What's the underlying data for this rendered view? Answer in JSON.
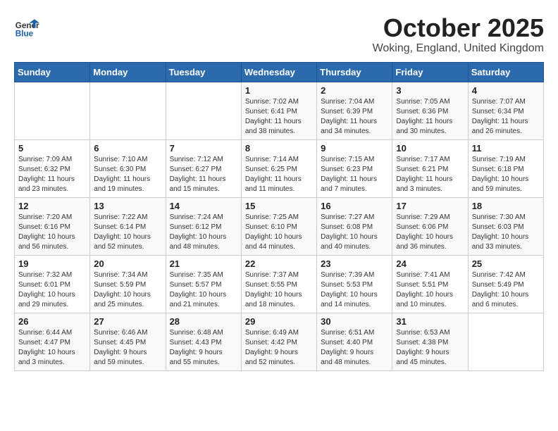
{
  "header": {
    "logo_line1": "General",
    "logo_line2": "Blue",
    "month_title": "October 2025",
    "location": "Woking, England, United Kingdom"
  },
  "weekdays": [
    "Sunday",
    "Monday",
    "Tuesday",
    "Wednesday",
    "Thursday",
    "Friday",
    "Saturday"
  ],
  "weeks": [
    [
      {
        "day": "",
        "info": ""
      },
      {
        "day": "",
        "info": ""
      },
      {
        "day": "",
        "info": ""
      },
      {
        "day": "1",
        "info": "Sunrise: 7:02 AM\nSunset: 6:41 PM\nDaylight: 11 hours\nand 38 minutes."
      },
      {
        "day": "2",
        "info": "Sunrise: 7:04 AM\nSunset: 6:39 PM\nDaylight: 11 hours\nand 34 minutes."
      },
      {
        "day": "3",
        "info": "Sunrise: 7:05 AM\nSunset: 6:36 PM\nDaylight: 11 hours\nand 30 minutes."
      },
      {
        "day": "4",
        "info": "Sunrise: 7:07 AM\nSunset: 6:34 PM\nDaylight: 11 hours\nand 26 minutes."
      }
    ],
    [
      {
        "day": "5",
        "info": "Sunrise: 7:09 AM\nSunset: 6:32 PM\nDaylight: 11 hours\nand 23 minutes."
      },
      {
        "day": "6",
        "info": "Sunrise: 7:10 AM\nSunset: 6:30 PM\nDaylight: 11 hours\nand 19 minutes."
      },
      {
        "day": "7",
        "info": "Sunrise: 7:12 AM\nSunset: 6:27 PM\nDaylight: 11 hours\nand 15 minutes."
      },
      {
        "day": "8",
        "info": "Sunrise: 7:14 AM\nSunset: 6:25 PM\nDaylight: 11 hours\nand 11 minutes."
      },
      {
        "day": "9",
        "info": "Sunrise: 7:15 AM\nSunset: 6:23 PM\nDaylight: 11 hours\nand 7 minutes."
      },
      {
        "day": "10",
        "info": "Sunrise: 7:17 AM\nSunset: 6:21 PM\nDaylight: 11 hours\nand 3 minutes."
      },
      {
        "day": "11",
        "info": "Sunrise: 7:19 AM\nSunset: 6:18 PM\nDaylight: 10 hours\nand 59 minutes."
      }
    ],
    [
      {
        "day": "12",
        "info": "Sunrise: 7:20 AM\nSunset: 6:16 PM\nDaylight: 10 hours\nand 56 minutes."
      },
      {
        "day": "13",
        "info": "Sunrise: 7:22 AM\nSunset: 6:14 PM\nDaylight: 10 hours\nand 52 minutes."
      },
      {
        "day": "14",
        "info": "Sunrise: 7:24 AM\nSunset: 6:12 PM\nDaylight: 10 hours\nand 48 minutes."
      },
      {
        "day": "15",
        "info": "Sunrise: 7:25 AM\nSunset: 6:10 PM\nDaylight: 10 hours\nand 44 minutes."
      },
      {
        "day": "16",
        "info": "Sunrise: 7:27 AM\nSunset: 6:08 PM\nDaylight: 10 hours\nand 40 minutes."
      },
      {
        "day": "17",
        "info": "Sunrise: 7:29 AM\nSunset: 6:06 PM\nDaylight: 10 hours\nand 36 minutes."
      },
      {
        "day": "18",
        "info": "Sunrise: 7:30 AM\nSunset: 6:03 PM\nDaylight: 10 hours\nand 33 minutes."
      }
    ],
    [
      {
        "day": "19",
        "info": "Sunrise: 7:32 AM\nSunset: 6:01 PM\nDaylight: 10 hours\nand 29 minutes."
      },
      {
        "day": "20",
        "info": "Sunrise: 7:34 AM\nSunset: 5:59 PM\nDaylight: 10 hours\nand 25 minutes."
      },
      {
        "day": "21",
        "info": "Sunrise: 7:35 AM\nSunset: 5:57 PM\nDaylight: 10 hours\nand 21 minutes."
      },
      {
        "day": "22",
        "info": "Sunrise: 7:37 AM\nSunset: 5:55 PM\nDaylight: 10 hours\nand 18 minutes."
      },
      {
        "day": "23",
        "info": "Sunrise: 7:39 AM\nSunset: 5:53 PM\nDaylight: 10 hours\nand 14 minutes."
      },
      {
        "day": "24",
        "info": "Sunrise: 7:41 AM\nSunset: 5:51 PM\nDaylight: 10 hours\nand 10 minutes."
      },
      {
        "day": "25",
        "info": "Sunrise: 7:42 AM\nSunset: 5:49 PM\nDaylight: 10 hours\nand 6 minutes."
      }
    ],
    [
      {
        "day": "26",
        "info": "Sunrise: 6:44 AM\nSunset: 4:47 PM\nDaylight: 10 hours\nand 3 minutes."
      },
      {
        "day": "27",
        "info": "Sunrise: 6:46 AM\nSunset: 4:45 PM\nDaylight: 9 hours\nand 59 minutes."
      },
      {
        "day": "28",
        "info": "Sunrise: 6:48 AM\nSunset: 4:43 PM\nDaylight: 9 hours\nand 55 minutes."
      },
      {
        "day": "29",
        "info": "Sunrise: 6:49 AM\nSunset: 4:42 PM\nDaylight: 9 hours\nand 52 minutes."
      },
      {
        "day": "30",
        "info": "Sunrise: 6:51 AM\nSunset: 4:40 PM\nDaylight: 9 hours\nand 48 minutes."
      },
      {
        "day": "31",
        "info": "Sunrise: 6:53 AM\nSunset: 4:38 PM\nDaylight: 9 hours\nand 45 minutes."
      },
      {
        "day": "",
        "info": ""
      }
    ]
  ]
}
